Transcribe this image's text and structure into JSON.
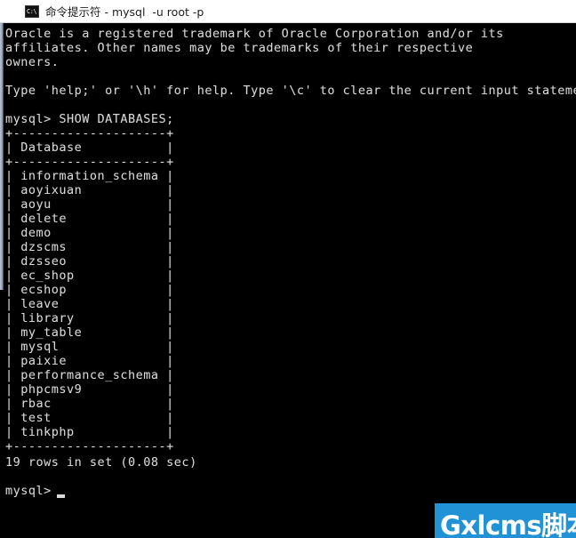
{
  "window": {
    "title": "命令提示符 - mysql  -u root -p",
    "icon_name": "console-icon",
    "icon_glyph": "C:\\"
  },
  "terminal": {
    "lines": [
      "Oracle is a registered trademark of Oracle Corporation and/or its",
      "affiliates. Other names may be trademarks of their respective",
      "owners.",
      "",
      "Type 'help;' or '\\h' for help. Type '\\c' to clear the current input statement.",
      "",
      "mysql> SHOW DATABASES;",
      "+--------------------+",
      "| Database           |",
      "+--------------------+",
      "| information_schema |",
      "| aoyixuan           |",
      "| aoyu               |",
      "| delete             |",
      "| demo               |",
      "| dzscms             |",
      "| dzsseo             |",
      "| ec_shop            |",
      "| ecshop             |",
      "| leave              |",
      "| library            |",
      "| my_table           |",
      "| mysql              |",
      "| paixie             |",
      "| performance_schema |",
      "| phpcmsv9           |",
      "| rbac               |",
      "| test               |",
      "| tinkphp            |",
      "+--------------------+",
      "19 rows in set (0.08 sec)",
      "",
      "mysql>"
    ],
    "prompt": "mysql>",
    "command": "SHOW DATABASES;",
    "result_table": {
      "header": "Database",
      "rows": [
        "information_schema",
        "aoyixuan",
        "aoyu",
        "delete",
        "demo",
        "dzscms",
        "dzsseo",
        "ec_shop",
        "ecshop",
        "leave",
        "library",
        "my_table",
        "mysql",
        "paixie",
        "performance_schema",
        "phpcmsv9",
        "rbac",
        "test",
        "tinkphp"
      ]
    },
    "status": "19 rows in set (0.08 sec)",
    "row_count": 19,
    "elapsed": "0.08 sec"
  },
  "watermark": {
    "text": "Gxlcms脚本",
    "background_color": "#2192d6",
    "text_color": "#ffffff"
  },
  "colors": {
    "terminal_background": "#000000",
    "terminal_foreground": "#d9d9d9",
    "titlebar_background": "#ffffff",
    "titlebar_foreground": "#202020"
  }
}
